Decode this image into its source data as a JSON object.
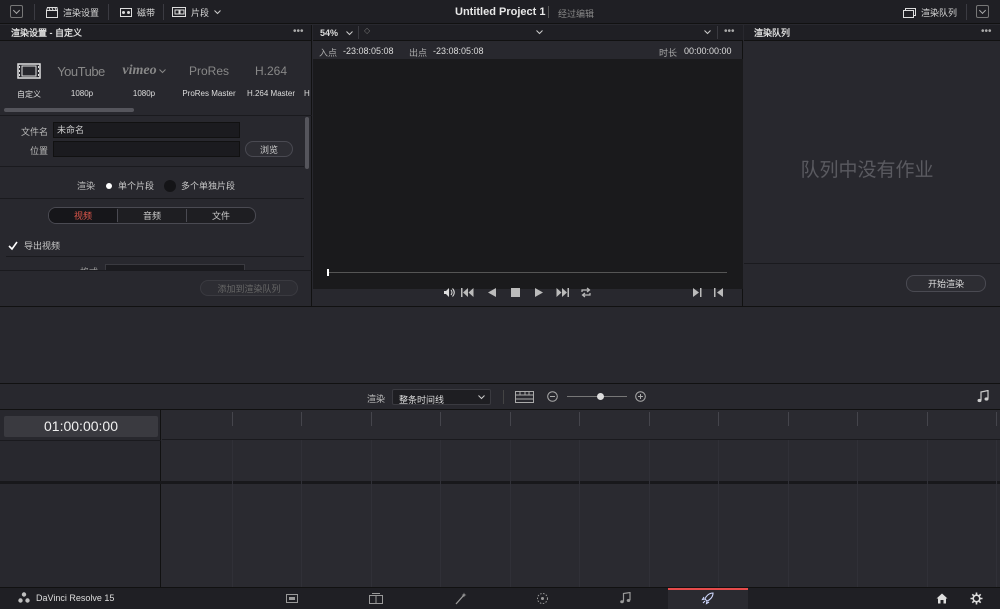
{
  "topbar": {
    "render_settings": "渲染设置",
    "tape": "磁带",
    "clips": "片段",
    "project_title": "Untitled Project 1",
    "edit_status": "经过编辑",
    "render_queue": "渲染队列"
  },
  "left": {
    "header": "渲染设置 - 自定义",
    "presets": [
      {
        "logo": "",
        "label": "自定义"
      },
      {
        "logo": "YouTube",
        "label": "1080p"
      },
      {
        "logo": "vimeo",
        "label": "1080p"
      },
      {
        "logo": "ProRes",
        "label": "ProRes Master"
      },
      {
        "logo": "H.264",
        "label": "H.264 Master"
      },
      {
        "logo": "",
        "label": "H"
      }
    ],
    "filename_label": "文件名",
    "filename_value": "未命名",
    "location_label": "位置",
    "location_value": "",
    "browse": "浏览",
    "render_label": "渲染",
    "single_clip": "单个片段",
    "multi_clips": "多个单独片段",
    "tabs": [
      "视频",
      "音频",
      "文件"
    ],
    "export_video": "导出视频",
    "format_label": "格式",
    "add_to_queue": "添加到渲染队列"
  },
  "viewer": {
    "zoom": "54%",
    "in_label": "入点",
    "in_tc": "-23:08:05:08",
    "out_label": "出点",
    "out_tc": "-23:08:05:08",
    "duration_label": "时长",
    "duration_tc": "00:00:00:00"
  },
  "queue": {
    "header": "渲染队列",
    "empty": "队列中没有作业",
    "start_render": "开始渲染"
  },
  "timeline_toolbar": {
    "render_label": "渲染",
    "range_value": "整条时间线",
    "zoom_level": 0.55
  },
  "timeline": {
    "timecode": "01:00:00:00"
  },
  "bottom": {
    "app_name": "DaVinci Resolve 15",
    "pages": [
      "media",
      "edit",
      "fusion",
      "color",
      "fairlight",
      "deliver"
    ],
    "active_page": "deliver",
    "accent": "#e64b4b"
  }
}
